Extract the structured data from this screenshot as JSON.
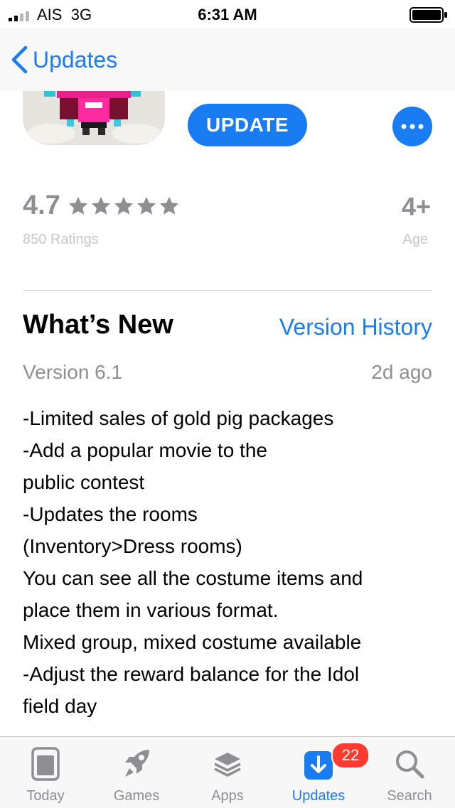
{
  "status_bar": {
    "carrier": "AIS",
    "network": "3G",
    "time": "6:31 AM"
  },
  "nav": {
    "back_label": "Updates"
  },
  "app": {
    "update_label": "UPDATE"
  },
  "ratings": {
    "value": "4.7",
    "stars": 5,
    "count_label": "850 Ratings",
    "age_value": "4+",
    "age_label": "Age"
  },
  "whats_new": {
    "title": "What’s New",
    "version_history_label": "Version History",
    "version": "Version 6.1",
    "date": "2d ago",
    "lines": [
      "-Limited sales of gold pig packages",
      "-Add a popular movie to the",
      "public contest",
      "-Updates the rooms",
      "(Inventory>Dress rooms)",
      "You can see all the costume items and",
      "place them in various format.",
      "Mixed group, mixed costume available",
      "-Adjust the reward balance for the Idol",
      "field day"
    ]
  },
  "tabbar": {
    "tabs": [
      {
        "label": "Today",
        "icon": "today-icon"
      },
      {
        "label": "Games",
        "icon": "rocket-icon"
      },
      {
        "label": "Apps",
        "icon": "layers-icon"
      },
      {
        "label": "Updates",
        "icon": "download-icon"
      },
      {
        "label": "Search",
        "icon": "search-icon"
      }
    ],
    "active_tab": "Updates",
    "updates_badge": "22"
  },
  "colors": {
    "accent": "#1a7cf2",
    "badge": "#ff3b30",
    "secondary_text": "#8e8e93"
  }
}
